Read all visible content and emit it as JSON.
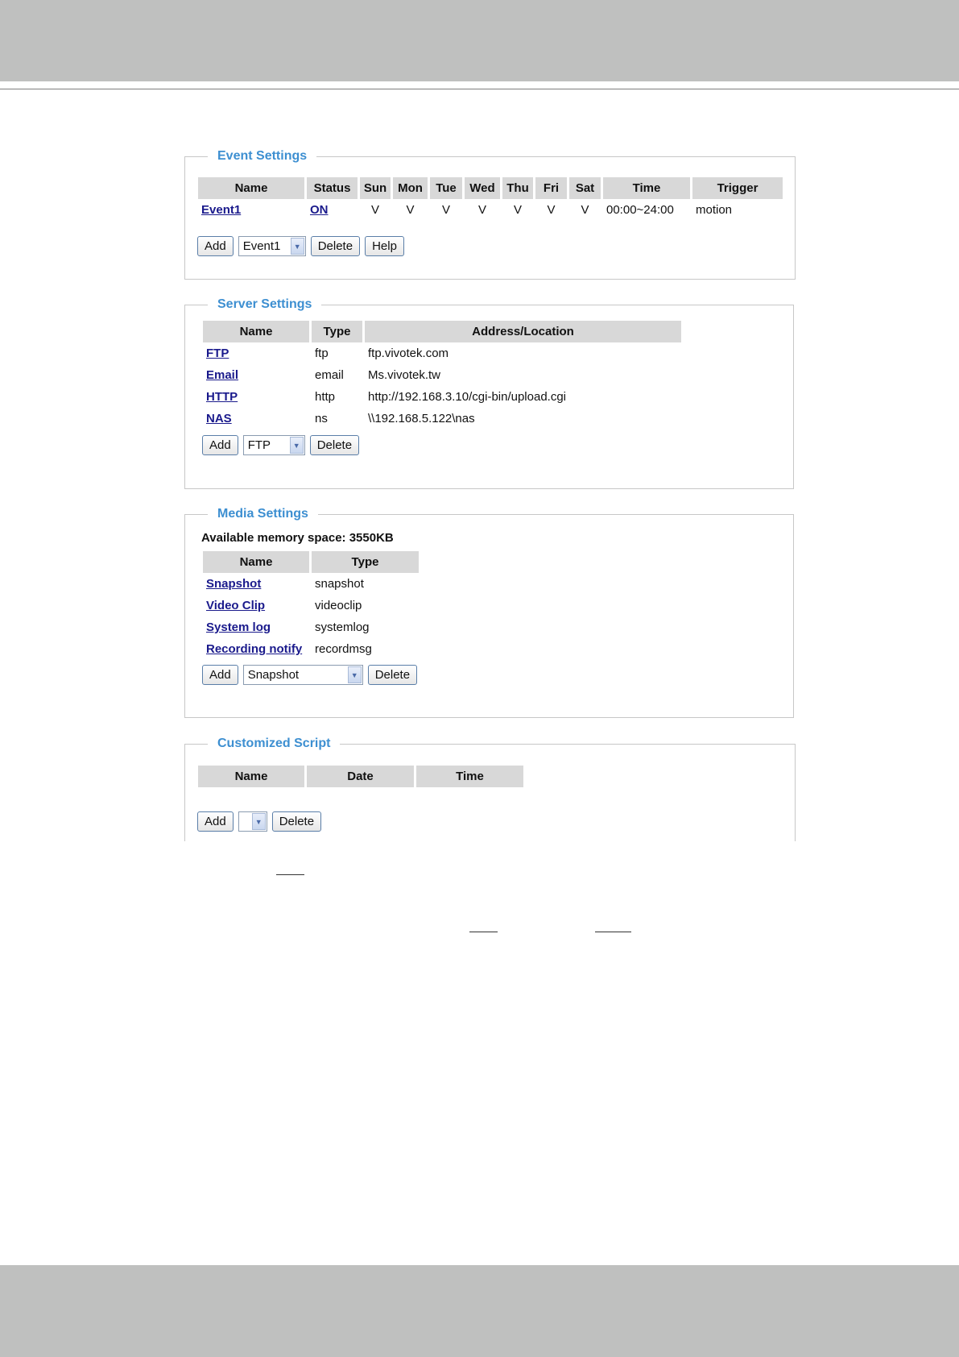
{
  "event_settings": {
    "legend": "Event Settings",
    "columns": [
      "Name",
      "Status",
      "Sun",
      "Mon",
      "Tue",
      "Wed",
      "Thu",
      "Fri",
      "Sat",
      "Time",
      "Trigger"
    ],
    "row": {
      "name": "Event1",
      "status": "ON",
      "days": [
        "V",
        "V",
        "V",
        "V",
        "V",
        "V",
        "V"
      ],
      "time": "00:00~24:00",
      "trigger": "motion"
    },
    "add_label": "Add",
    "select_value": "Event1",
    "delete_label": "Delete",
    "help_label": "Help"
  },
  "server_settings": {
    "legend": "Server Settings",
    "columns": [
      "Name",
      "Type",
      "Address/Location"
    ],
    "rows": [
      {
        "name": "FTP",
        "type": "ftp",
        "address": "ftp.vivotek.com"
      },
      {
        "name": "Email",
        "type": "email",
        "address": "Ms.vivotek.tw"
      },
      {
        "name": "HTTP",
        "type": "http",
        "address": "http://192.168.3.10/cgi-bin/upload.cgi"
      },
      {
        "name": "NAS",
        "type": "ns",
        "address": "\\\\192.168.5.122\\nas"
      }
    ],
    "add_label": "Add",
    "select_value": "FTP",
    "delete_label": "Delete"
  },
  "media_settings": {
    "legend": "Media Settings",
    "memory_text": "Available memory space: 3550KB",
    "columns": [
      "Name",
      "Type"
    ],
    "rows": [
      {
        "name": "Snapshot",
        "type": "snapshot"
      },
      {
        "name": "Video Clip",
        "type": "videoclip"
      },
      {
        "name": "System log",
        "type": "systemlog"
      },
      {
        "name": "Recording notify",
        "type": "recordmsg"
      }
    ],
    "add_label": "Add",
    "select_value": "Snapshot",
    "delete_label": "Delete"
  },
  "customized_script": {
    "legend": "Customized Script",
    "columns": [
      "Name",
      "Date",
      "Time"
    ],
    "add_label": "Add",
    "select_value": "",
    "delete_label": "Delete"
  }
}
